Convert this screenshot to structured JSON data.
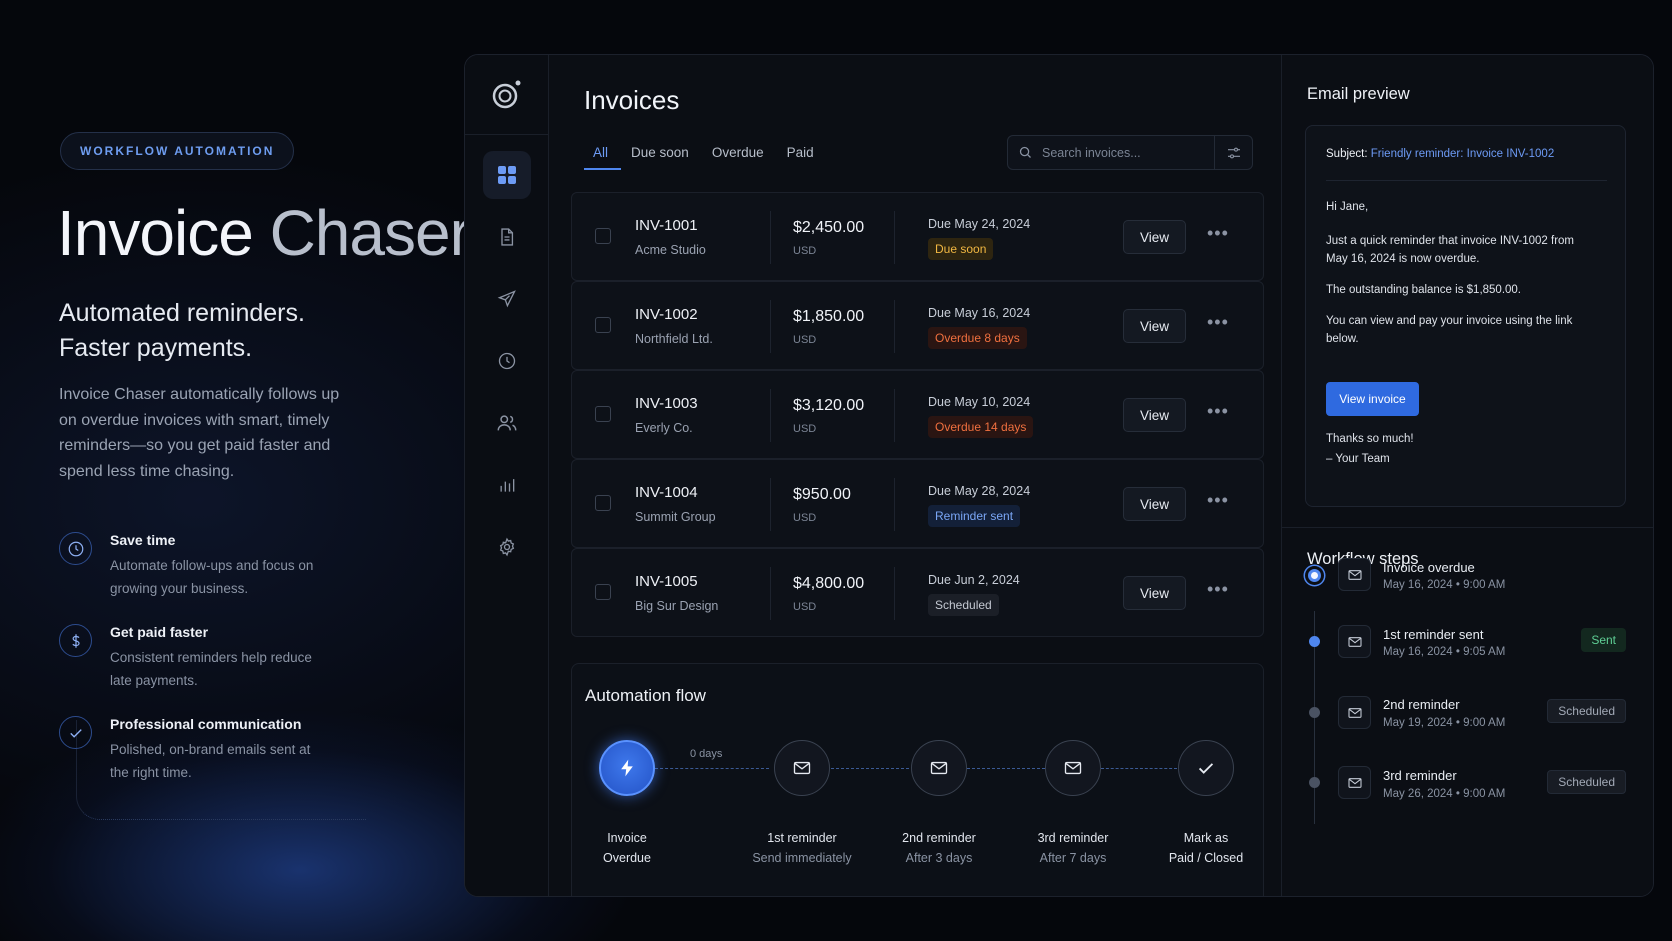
{
  "hero": {
    "pill": "WORKFLOW AUTOMATION",
    "title_part1": "Invoice",
    "title_part2": "Chaser",
    "tagline_line1": "Automated reminders.",
    "tagline_line2": "Faster payments.",
    "description": "Invoice Chaser automatically follows up on overdue invoices with smart, timely reminders—so you get paid faster and spend less time chasing.",
    "features": [
      {
        "title": "Save time",
        "desc": "Automate follow-ups and focus on growing your business.",
        "icon": "clock-icon"
      },
      {
        "title": "Get paid faster",
        "desc": "Consistent reminders help reduce late payments.",
        "icon": "dollar-icon"
      },
      {
        "title": "Professional communication",
        "desc": "Polished, on-brand emails sent at the right time.",
        "icon": "check-icon"
      }
    ]
  },
  "rail": {
    "items": [
      {
        "name": "dashboard",
        "icon": "grid-icon",
        "active": true
      },
      {
        "name": "invoices",
        "icon": "document-icon"
      },
      {
        "name": "send",
        "icon": "paper-plane-icon"
      },
      {
        "name": "history",
        "icon": "clock-icon"
      },
      {
        "name": "clients",
        "icon": "users-icon"
      },
      {
        "name": "reports",
        "icon": "bar-chart-icon"
      },
      {
        "name": "settings",
        "icon": "gear-icon"
      }
    ]
  },
  "invoices": {
    "title": "Invoices",
    "tabs": [
      "All",
      "Due soon",
      "Overdue",
      "Paid"
    ],
    "active_tab": "All",
    "search_placeholder": "Search invoices...",
    "view_label": "View",
    "more_label": "•••",
    "rows": [
      {
        "id": "INV-1001",
        "client": "Acme Studio",
        "amount": "$2,450.00",
        "currency": "USD",
        "due": "Due May 24, 2024",
        "status": "Due soon",
        "status_kind": "amber"
      },
      {
        "id": "INV-1002",
        "client": "Northfield Ltd.",
        "amount": "$1,850.00",
        "currency": "USD",
        "due": "Due May 16, 2024",
        "status": "Overdue 8 days",
        "status_kind": "red"
      },
      {
        "id": "INV-1003",
        "client": "Everly Co.",
        "amount": "$3,120.00",
        "currency": "USD",
        "due": "Due May 10, 2024",
        "status": "Overdue 14 days",
        "status_kind": "red"
      },
      {
        "id": "INV-1004",
        "client": "Summit Group",
        "amount": "$950.00",
        "currency": "USD",
        "due": "Due May 28, 2024",
        "status": "Reminder sent",
        "status_kind": "blue"
      },
      {
        "id": "INV-1005",
        "client": "Big Sur Design",
        "amount": "$4,800.00",
        "currency": "USD",
        "due": "Due Jun 2, 2024",
        "status": "Scheduled",
        "status_kind": "gray"
      }
    ]
  },
  "flow": {
    "title": "Automation flow",
    "connector_label": "0 days",
    "steps": [
      {
        "line1": "Invoice",
        "line2": "Overdue",
        "icon": "lightning-icon"
      },
      {
        "line1": "1st reminder",
        "line2": "Send immediately",
        "icon": "mail-icon"
      },
      {
        "line1": "2nd reminder",
        "line2": "After 3 days",
        "icon": "mail-icon"
      },
      {
        "line1": "3rd reminder",
        "line2": "After 7 days",
        "icon": "mail-icon"
      },
      {
        "line1": "Mark as",
        "line2": "Paid / Closed",
        "icon": "check-icon"
      }
    ]
  },
  "email": {
    "title": "Email preview",
    "subject_label": "Subject:",
    "subject": "Friendly reminder: Invoice INV-1002",
    "greeting": "Hi Jane,",
    "p1_a": "Just a quick reminder that invoice ",
    "p1_b": "INV-1002",
    "p1_c": " from May 16, 2024 is now overdue.",
    "p2": "The outstanding balance is $1,850.00.",
    "p3": "You can view and pay your invoice using the link below.",
    "button": "View invoice",
    "signoff1": "Thanks so much!",
    "signoff2": "– Your Team"
  },
  "workflow": {
    "title": "Workflow steps",
    "steps": [
      {
        "name": "Invoice overdue",
        "time": "May 16, 2024 • 9:00 AM",
        "badge": ""
      },
      {
        "name": "1st reminder sent",
        "time": "May 16, 2024 • 9:05 AM",
        "badge": "Sent"
      },
      {
        "name": "2nd reminder",
        "time": "May 19, 2024 • 9:00 AM",
        "badge": "Scheduled"
      },
      {
        "name": "3rd reminder",
        "time": "May 26, 2024 • 9:00 AM",
        "badge": "Scheduled"
      }
    ]
  },
  "colors": {
    "accent": "#4f86ee",
    "amber": "#f1b742",
    "red": "#f0703f",
    "green": "#5fcf95"
  }
}
